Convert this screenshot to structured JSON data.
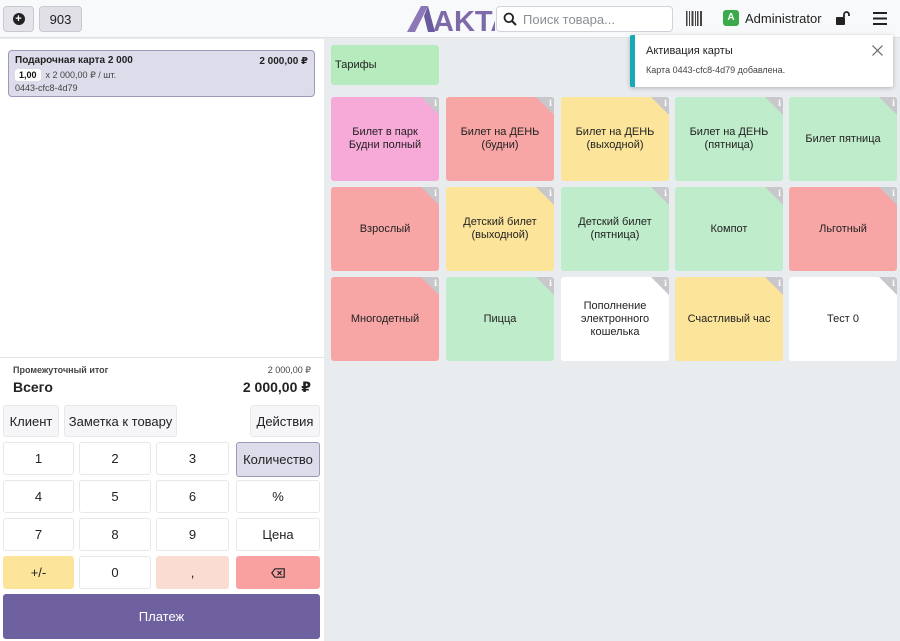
{
  "header": {
    "add_icon": "plus-circle-icon",
    "order_number": "903",
    "logo_text": "AKTA",
    "search_placeholder": "Поиск товара...",
    "user_initial": "A",
    "user_name": "Administrator"
  },
  "cart": {
    "items": [
      {
        "name": "Подарочная карта 2 000",
        "price": "2 000,00 ₽",
        "qty": "1,00",
        "unit_price": "x 2 000,00 ₽ / шт.",
        "code": "0443-cfc8-4d79"
      }
    ],
    "subtotal_label": "Промежуточный итог",
    "subtotal_value": "2 000,00 ₽",
    "total_label": "Всего",
    "total_value": "2 000,00 ₽"
  },
  "actions": {
    "client": "Клиент",
    "note": "Заметка к товару",
    "actions": "Действия"
  },
  "keypad": {
    "k1": "1",
    "k2": "2",
    "k3": "3",
    "quantity": "Количество",
    "k4": "4",
    "k5": "5",
    "k6": "6",
    "percent": "%",
    "k7": "7",
    "k8": "8",
    "k9": "9",
    "price": "Цена",
    "plusminus": "+/-",
    "k0": "0",
    "comma": ","
  },
  "payment": "Платеж",
  "category": "Тарифы",
  "products": [
    {
      "name": "Билет в парк Будни полный",
      "color": "#f7a9d8"
    },
    {
      "name": "Билет на ДЕНЬ (будни)",
      "color": "#f7a5a5"
    },
    {
      "name": "Билет на ДЕНЬ (выходной)",
      "color": "#fce59a"
    },
    {
      "name": "Билет на ДЕНЬ (пятница)",
      "color": "#bfeccb"
    },
    {
      "name": "Билет пятница",
      "color": "#bfeccb"
    },
    {
      "name": "Взрослый",
      "color": "#f7a5a5"
    },
    {
      "name": "Детский билет (выходной)",
      "color": "#fce59a"
    },
    {
      "name": "Детский билет (пятница)",
      "color": "#bfeccb"
    },
    {
      "name": "Компот",
      "color": "#bfeccb"
    },
    {
      "name": "Льготный",
      "color": "#f7a5a5"
    },
    {
      "name": "Многодетный",
      "color": "#f7a5a5"
    },
    {
      "name": "Пицца",
      "color": "#bfeccb"
    },
    {
      "name": "Пополнение электронного кошелька",
      "color": "#ffffff"
    },
    {
      "name": "Счастливый час",
      "color": "#fce59a"
    },
    {
      "name": "Тест 0",
      "color": "#ffffff"
    }
  ],
  "toast": {
    "title": "Активация карты",
    "message": "Карта 0443-cfc8-4d79 добавлена."
  }
}
